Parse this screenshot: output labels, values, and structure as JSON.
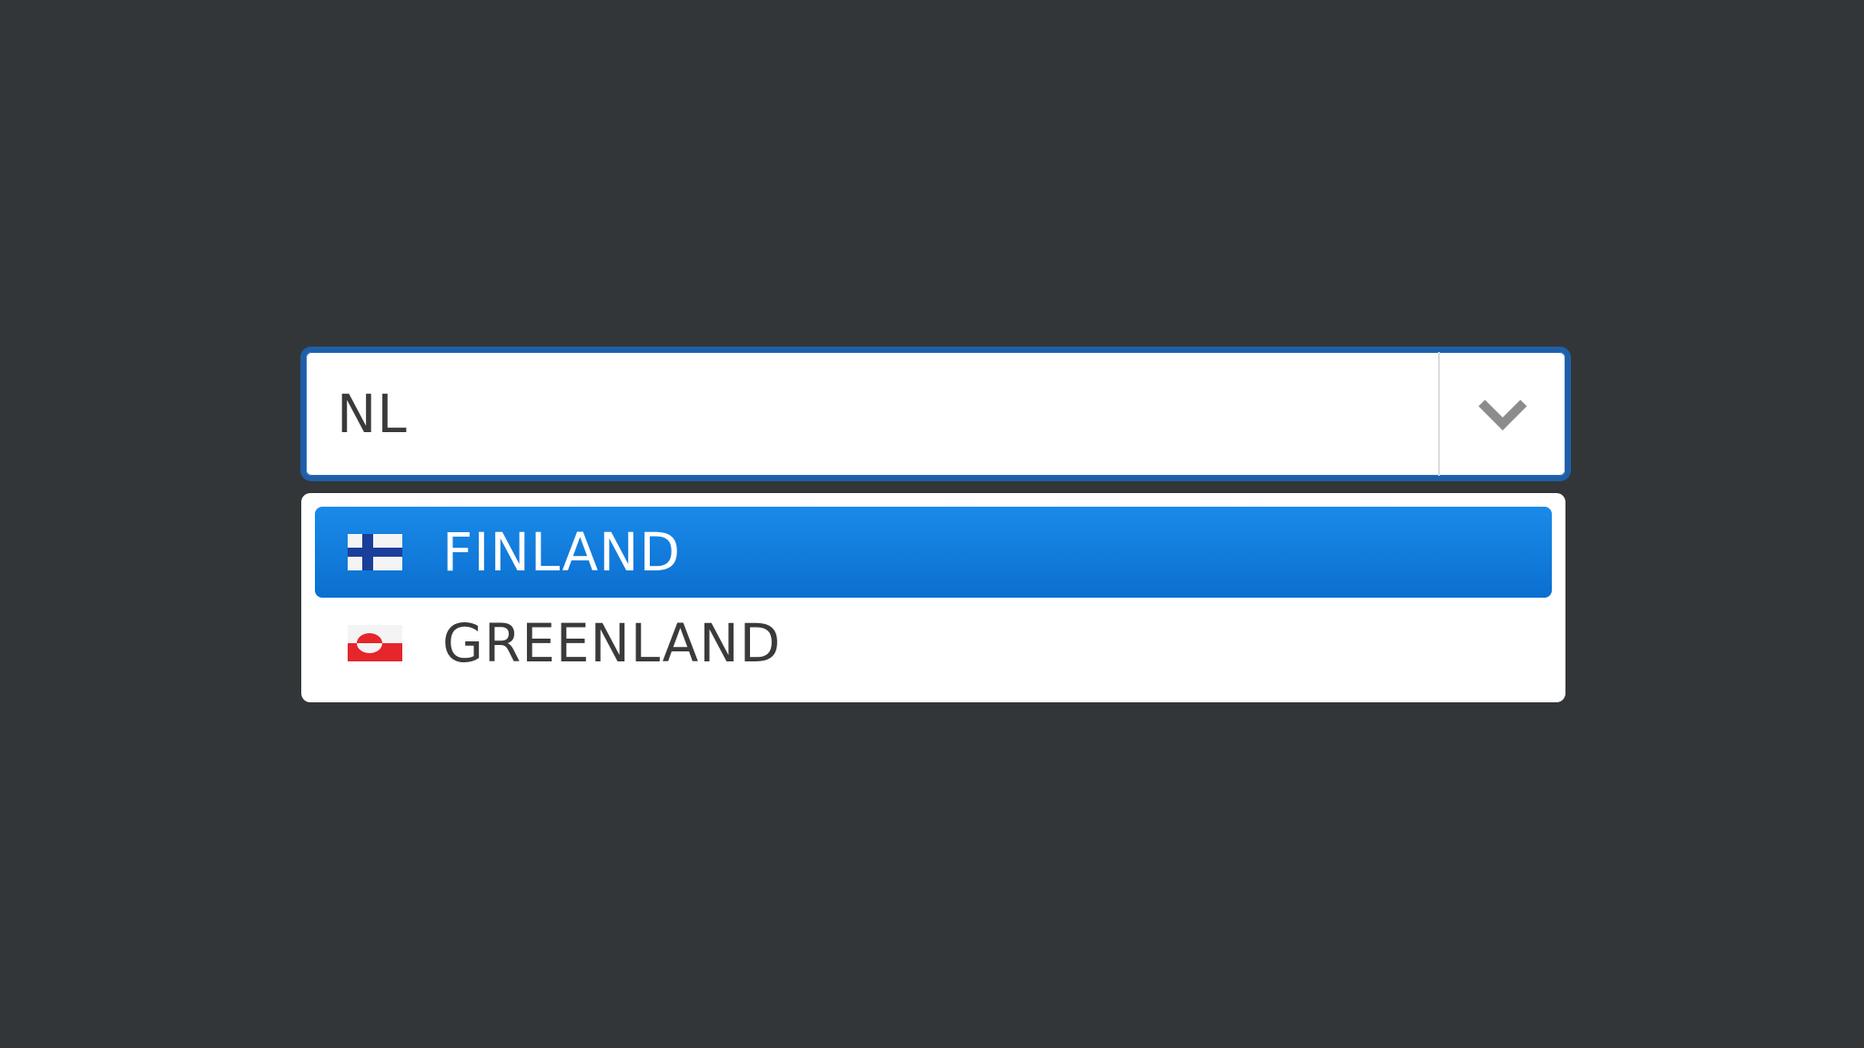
{
  "combobox": {
    "value": "NL",
    "toggle_icon": "chevron-down-icon"
  },
  "dropdown": {
    "options": [
      {
        "label": "FINLAND",
        "flag_icon": "finland-flag-icon",
        "highlighted": true
      },
      {
        "label": "GREENLAND",
        "flag_icon": "greenland-flag-icon",
        "highlighted": false
      }
    ]
  },
  "colors": {
    "background": "#333638",
    "focus_border": "#1f5fa8",
    "highlight": "#0b6fd0",
    "text": "#3a3a3a"
  }
}
